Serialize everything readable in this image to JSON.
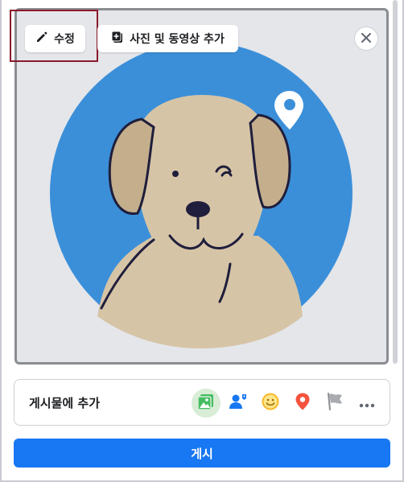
{
  "media": {
    "edit_label": "수정",
    "add_media_label": "사진 및 동영상 추가",
    "edit_icon": "pencil-icon",
    "add_media_icon": "photo-stack-icon",
    "close_icon": "close-icon",
    "image_subject": "dog-avatar-illustration"
  },
  "composer": {
    "add_to_post_label": "게시물에 추가",
    "tools": [
      {
        "name": "photo-video",
        "icon": "photo-icon",
        "color": "#45bd62"
      },
      {
        "name": "tag-people",
        "icon": "tag-people-icon",
        "color": "#1877f2"
      },
      {
        "name": "feeling-activity",
        "icon": "smiley-icon",
        "color": "#f7b928"
      },
      {
        "name": "check-in",
        "icon": "location-pin-icon",
        "color": "#f5533d"
      },
      {
        "name": "life-event",
        "icon": "flag-icon",
        "color": "#8a8d91"
      },
      {
        "name": "more",
        "icon": "more-icon",
        "color": "#606770"
      }
    ],
    "post_label": "게시"
  },
  "colors": {
    "primary": "#1877f2",
    "avatar_bg": "#3b8fd9",
    "dog_fur": "#d6c4a6",
    "dog_ear": "#c4ae8c",
    "highlight": "#8b1a2b"
  }
}
